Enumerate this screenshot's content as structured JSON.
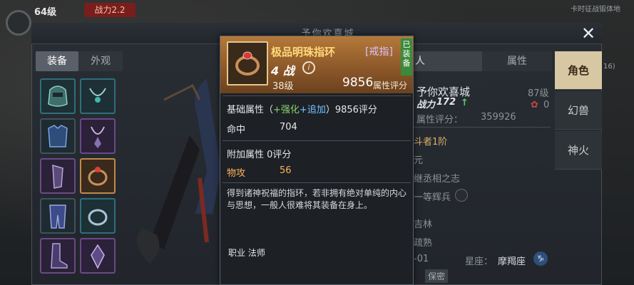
{
  "hud": {
    "level": "64级",
    "badge": "战力2.2",
    "right_text": "卡时征战锻体地",
    "right_text2": "16)"
  },
  "panel": {
    "title": "予你欢喜城",
    "close_icon": "close-icon",
    "tabs": {
      "equip": "装备",
      "look": "外观"
    },
    "right_tabs": {
      "info": "人",
      "attr": "属性"
    },
    "side_tabs": [
      "角色",
      "幻兽",
      "神火"
    ]
  },
  "profile": {
    "name": "予你欢喜城",
    "level": "87级",
    "power_label": "战力",
    "power_value": "172",
    "up_arrow": "↑",
    "attr_score_label": "属性评分：",
    "attr_score": "359926",
    "flower_count": "0",
    "rank_line": "斗者1阶",
    "line_yuan": "元",
    "line_will": "继丞相之志",
    "line_soldier": "一等辉兵",
    "line_forest": "吉林",
    "line_familiar": "疏熟",
    "line_date": "-01",
    "constellation_label": "星座：",
    "constellation_value": "摩羯座",
    "constellation_symbol": "♑",
    "secret_label": "保密"
  },
  "tooltip": {
    "name": "极品明珠指环",
    "type": "[戒指]",
    "equipped_badge": "已装备",
    "power_text": "4 战",
    "info_icon": "i",
    "level": "38级",
    "score": "9856",
    "score_label": "属性评分",
    "base_title": "基础属性（",
    "base_plus_a": "+强化",
    "base_plus_b": "+追加",
    "base_tail": "）9856评分",
    "hit_label": "命中",
    "hit_value": "704",
    "add_title": "附加属性 0评分",
    "atk_label": "物攻",
    "atk_value": "56",
    "description": "得到诸神祝福的指环，若非拥有绝对单纯的内心与思想，一般人很难将其装备在身上。",
    "class_label": "职业  法师"
  },
  "colors": {
    "accent_gold": "#ffd97a",
    "ring_type": "#dcc2ff",
    "plus_green": "#8bd36f",
    "plus_blue": "#6fc3ff",
    "attack_orange": "#ffb35c",
    "badge_green": "#3b8a3b",
    "side_active": "#d7c7a3"
  }
}
